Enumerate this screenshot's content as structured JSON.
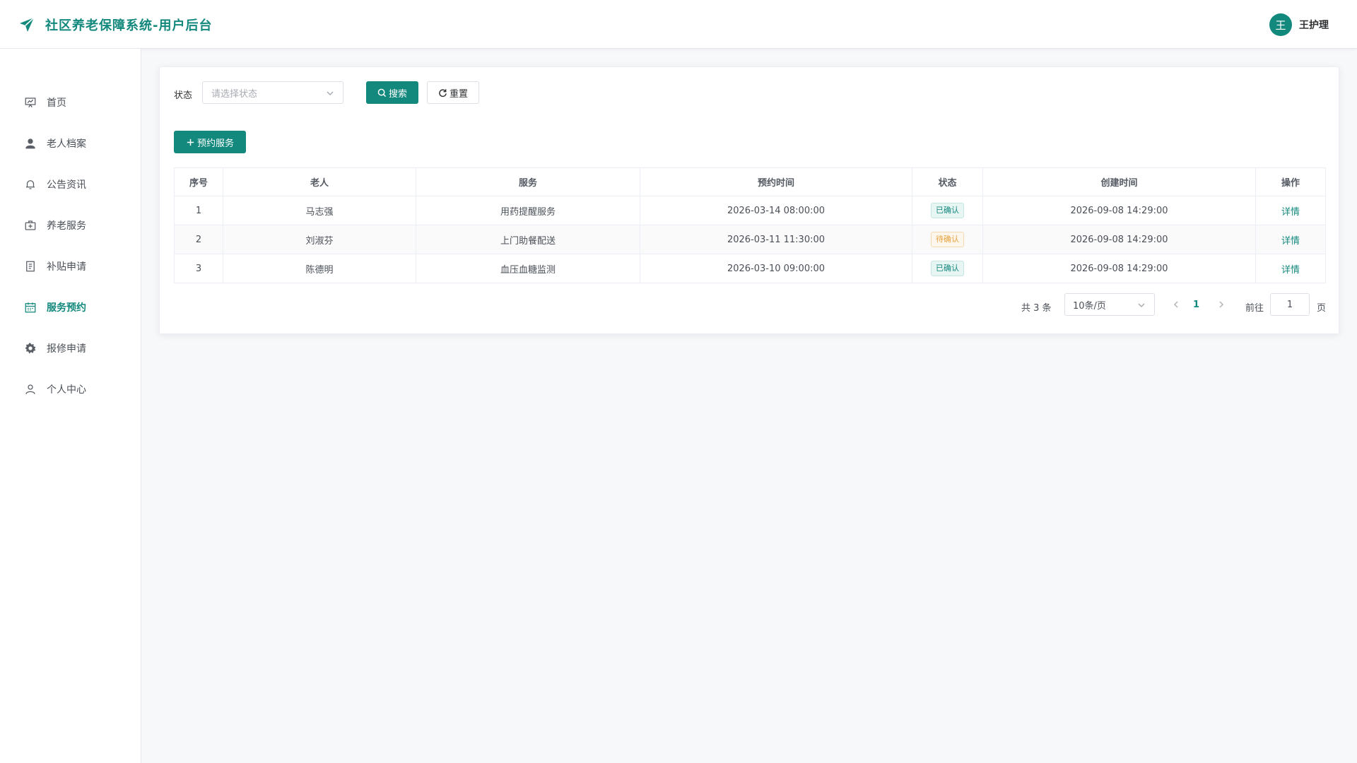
{
  "app": {
    "title": "社区养老保障系统-用户后台"
  },
  "user": {
    "avatar_initial": "王",
    "name": "王护理"
  },
  "sidebar": {
    "items": [
      {
        "label": "首页",
        "icon": "presentation-chart-icon"
      },
      {
        "label": "老人档案",
        "icon": "user-icon"
      },
      {
        "label": "公告资讯",
        "icon": "bell-icon"
      },
      {
        "label": "养老服务",
        "icon": "first-aid-kit-icon"
      },
      {
        "label": "补贴申请",
        "icon": "document-icon"
      },
      {
        "label": "服务预约",
        "icon": "calendar-icon",
        "active": true
      },
      {
        "label": "报修申请",
        "icon": "gear-icon"
      },
      {
        "label": "个人中心",
        "icon": "user-outline-icon"
      }
    ]
  },
  "filter": {
    "status_label": "状态",
    "status_placeholder": "请选择状态",
    "search_label": "搜索",
    "reset_label": "重置"
  },
  "actions": {
    "add_label": "预约服务"
  },
  "table": {
    "columns": [
      "序号",
      "老人",
      "服务",
      "预约时间",
      "状态",
      "创建时间",
      "操作"
    ],
    "rows": [
      {
        "index": "1",
        "elder": "马志强",
        "service": "用药提醒服务",
        "appointment_time": "2026-03-14 08:00:00",
        "status": "已确认",
        "created_at": "2026-09-08 14:29:00",
        "action": "详情"
      },
      {
        "index": "2",
        "elder": "刘淑芬",
        "service": "上门助餐配送",
        "appointment_time": "2026-03-11 11:30:00",
        "status": "待确认",
        "created_at": "2026-09-08 14:29:00",
        "action": "详情"
      },
      {
        "index": "3",
        "elder": "陈德明",
        "service": "血压血糖监测",
        "appointment_time": "2026-03-10 09:00:00",
        "status": "已确认",
        "created_at": "2026-09-08 14:29:00",
        "action": "详情"
      }
    ]
  },
  "pagination": {
    "total_text": "共 3 条",
    "page_size": "10条/页",
    "current_page": "1",
    "goto_label": "前往",
    "goto_value": "1",
    "page_suffix": "页"
  },
  "colors": {
    "accent": "#13887d",
    "warning": "#e6a23c"
  }
}
